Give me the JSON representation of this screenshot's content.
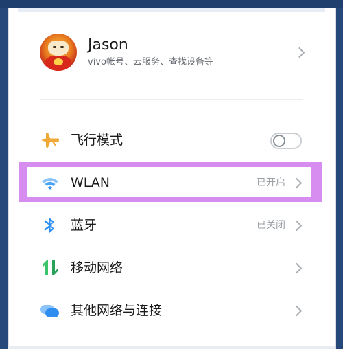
{
  "profile": {
    "name": "Jason",
    "subtitle": "vivo帐号、云服务、查找设备等"
  },
  "settings": [
    {
      "id": "airplane",
      "label": "飞行模式",
      "icon": "airplane-icon",
      "control": "toggle",
      "toggle_on": false
    },
    {
      "id": "wlan",
      "label": "WLAN",
      "icon": "wifi-icon",
      "status": "已开启",
      "highlighted": true
    },
    {
      "id": "bluetooth",
      "label": "蓝牙",
      "icon": "bluetooth-icon",
      "status": "已关闭"
    },
    {
      "id": "mobile-network",
      "label": "移动网络",
      "icon": "mobile-data-icon"
    },
    {
      "id": "other-networks",
      "label": "其他网络与连接",
      "icon": "other-networks-icon"
    }
  ],
  "colors": {
    "highlight": "#d78cf0",
    "frame": "#27487a",
    "airplane": "#f0a836",
    "wifi": "#2f8ff0",
    "bluetooth": "#2f8ff0",
    "mobile_up": "#3cc46a",
    "mobile_down": "#28a25a"
  }
}
